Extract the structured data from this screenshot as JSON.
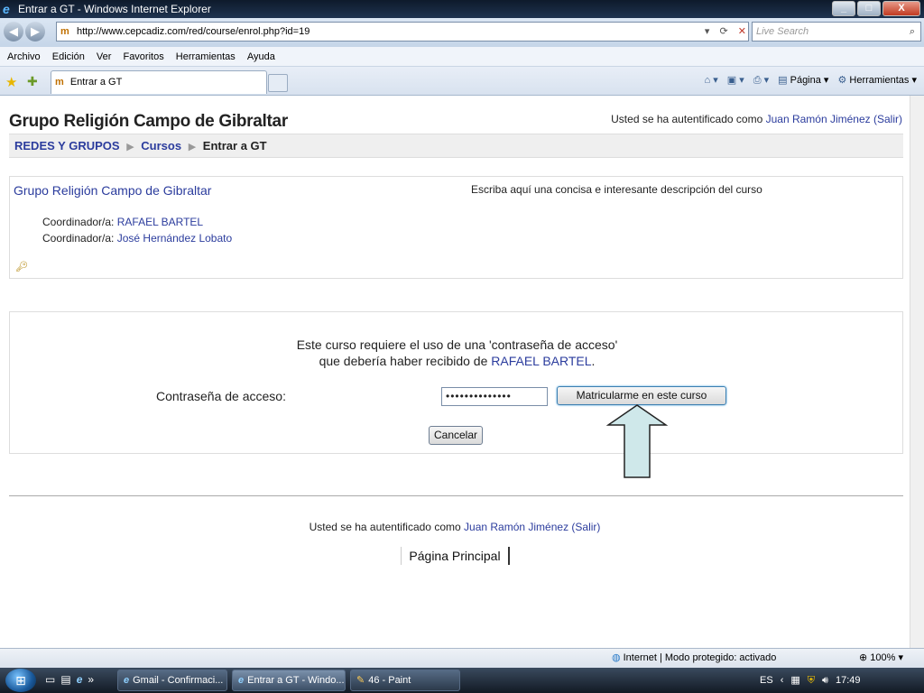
{
  "window": {
    "title": "Entrar a GT - Windows Internet Explorer",
    "minimize": "_",
    "maximize": "□",
    "close": "X"
  },
  "address": {
    "url": "http://www.cepcadiz.com/red/course/enrol.php?id=19",
    "search_placeholder": "Live Search"
  },
  "menu": [
    "Archivo",
    "Edición",
    "Ver",
    "Favoritos",
    "Herramientas",
    "Ayuda"
  ],
  "tab": {
    "label": "Entrar a GT"
  },
  "commandbar": {
    "page_label": "Página",
    "tools_label": "Herramientas"
  },
  "page": {
    "site_name": "Grupo Religión Campo de Gibraltar",
    "login_prefix": "Usted se ha autentificado como",
    "user_name": "Juan Ramón Jiménez",
    "logout_label": "(Salir)",
    "breadcrumb": {
      "root": "REDES Y GRUPOS",
      "courses": "Cursos",
      "current": "Entrar a GT"
    },
    "course": {
      "name": "Grupo Religión Campo de Gibraltar",
      "description": "Escriba aquí una concisa e interesante descripción del curso",
      "coordinator_label": "Coordinador/a:",
      "coordinators": [
        "RAFAEL BARTEL",
        "José Hernández Lobato"
      ]
    },
    "enrol": {
      "message_line1": "Este curso requiere el uso de una 'contraseña de acceso'",
      "message_line2_prefix": "que debería haber recibido de",
      "teacher": "RAFAEL BARTEL",
      "password_label": "Contraseña de acceso:",
      "password_value": "••••••••••••••",
      "enrol_button": "Matricularme en este curso",
      "cancel_button": "Cancelar"
    },
    "footer": {
      "login_prefix": "Usted se ha autentificado como",
      "user_name": "Juan Ramón Jiménez",
      "logout_label": "(Salir)",
      "home_button": "Página Principal"
    }
  },
  "statusbar": {
    "zone": "Internet | Modo protegido: activado",
    "zoom": "100%"
  },
  "taskbar": {
    "tasks": [
      "Gmail - Confirmaci...",
      "Entrar a GT - Windo...",
      "46 - Paint"
    ],
    "language": "ES",
    "clock": "17:49"
  },
  "colors": {
    "link": "#2b3c9d",
    "arrow_fill": "#cfe8ea"
  }
}
